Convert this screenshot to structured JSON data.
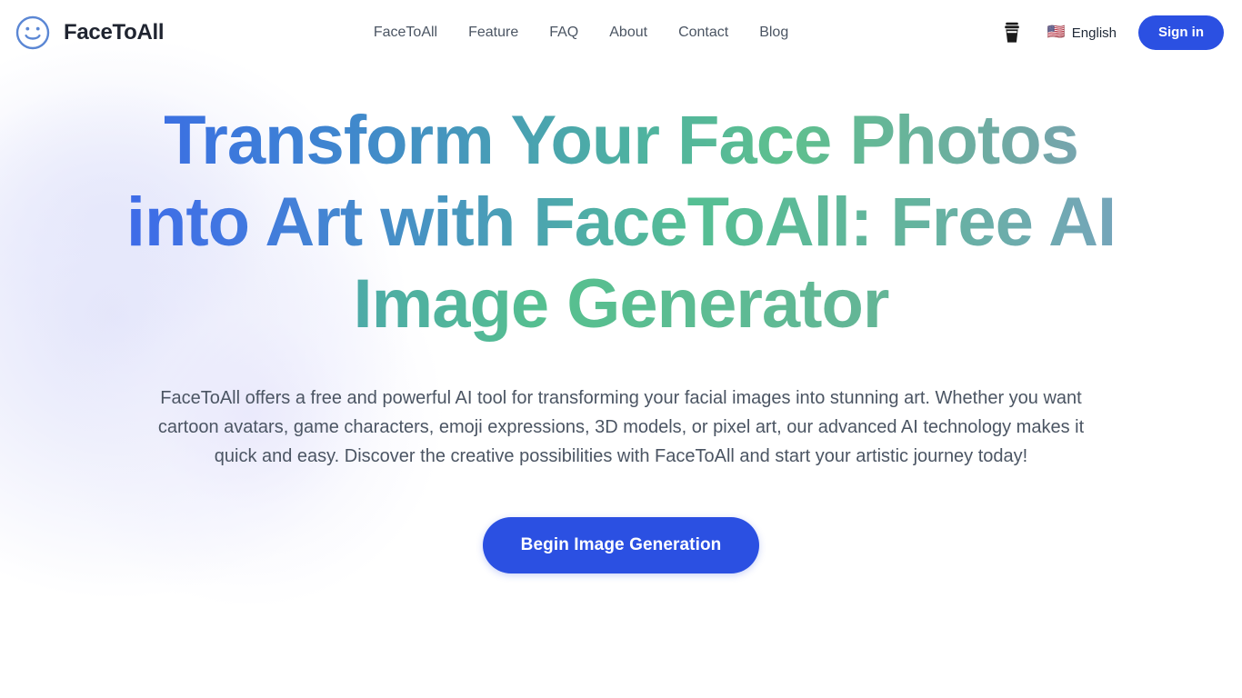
{
  "header": {
    "brand": {
      "name": "FaceToAll",
      "icon": "smiley-face-icon"
    },
    "nav": [
      {
        "label": "FaceToAll"
      },
      {
        "label": "Feature"
      },
      {
        "label": "FAQ"
      },
      {
        "label": "About"
      },
      {
        "label": "Contact"
      },
      {
        "label": "Blog"
      }
    ],
    "coffee": {
      "icon": "coffee-cup-icon"
    },
    "language": {
      "flag": "🇺🇸",
      "label": "English"
    },
    "signin_label": "Sign in"
  },
  "hero": {
    "title_lines": [
      "Transform Your Face Photos",
      "into Art with FaceToAll: Free AI",
      "Image Generator"
    ],
    "subtitle": "FaceToAll offers a free and powerful AI tool for transforming your facial images into stunning art. Whether you want cartoon avatars, game characters, emoji expressions, 3D models, or pixel art, our advanced AI technology makes it quick and easy. Discover the creative possibilities with FaceToAll and start your artistic journey today!",
    "cta_label": "Begin Image Generation"
  },
  "colors": {
    "brand_blue": "#2b50e2",
    "logo_blue": "#5b87d4",
    "gradient_start": "#3b60ef",
    "gradient_mid": "#56c08f",
    "gradient_end": "#7f9fc4",
    "text_body": "#4b5563",
    "background": "#ffffff",
    "glow_lavender": "#e7e9fb"
  }
}
